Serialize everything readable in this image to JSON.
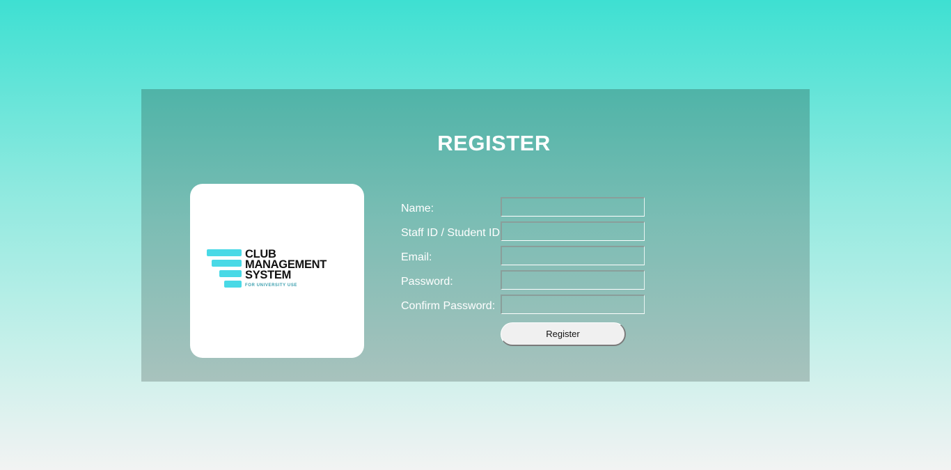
{
  "page": {
    "title": "REGISTER"
  },
  "logo": {
    "line1": "CLUB",
    "line2": "MANAGEMENT",
    "line3": "SYSTEM",
    "tagline": "FOR UNIVERSITY USE",
    "accent_color": "#49d9e6"
  },
  "form": {
    "fields": [
      {
        "label": "Name:",
        "value": ""
      },
      {
        "label": "Staff ID / Student ID:",
        "value": ""
      },
      {
        "label": "Email:",
        "value": ""
      },
      {
        "label": "Password:",
        "value": ""
      },
      {
        "label": "Confirm Password:",
        "value": ""
      }
    ],
    "submit_label": "Register"
  },
  "colors": {
    "page_gradient_top": "#3ee0d2",
    "page_gradient_bottom": "#f2f3f3",
    "card_gradient_top": "#4fb4a8",
    "card_gradient_bottom": "#a8c2bd"
  }
}
